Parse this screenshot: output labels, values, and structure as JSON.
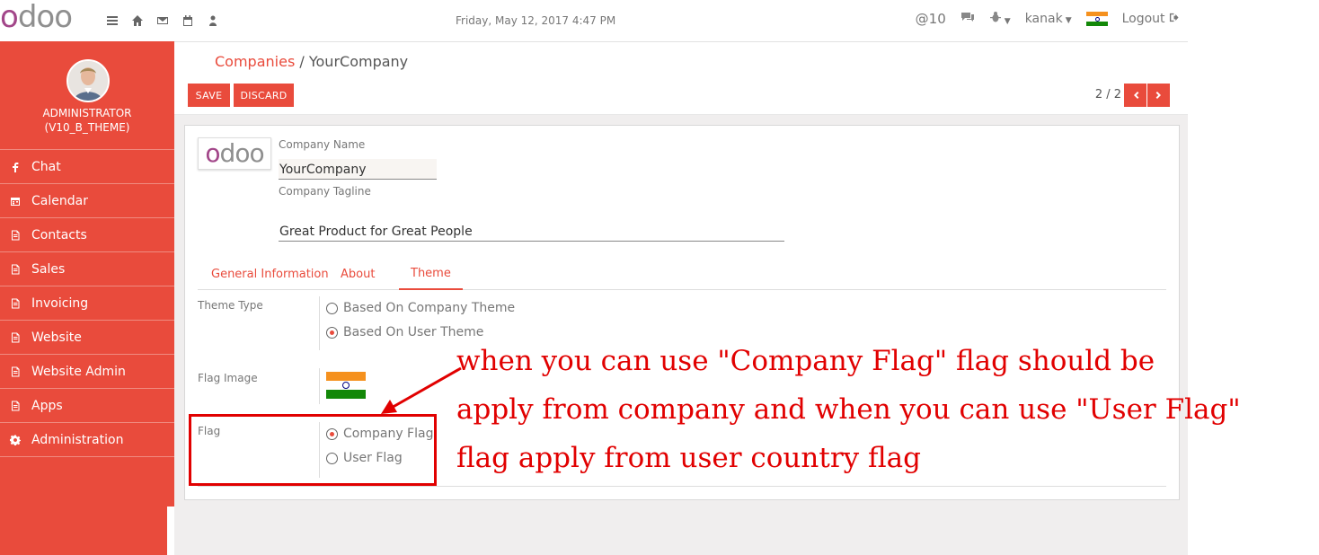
{
  "topbar": {
    "logo_first": "o",
    "logo_rest": "doo",
    "datetime": "Friday, May 12, 2017 4:47 PM",
    "mentions": "@10",
    "user": "kanak",
    "logout": "Logout",
    "icons": [
      "menu-icon",
      "home-icon",
      "envelope-icon",
      "calendar-icon",
      "user-icon"
    ]
  },
  "sidebar": {
    "user_line1": "ADMINISTRATOR",
    "user_line2": "(V10_B_THEME)",
    "items": [
      {
        "label": "Chat",
        "icon": "facebook-icon"
      },
      {
        "label": "Calendar",
        "icon": "calendar-icon"
      },
      {
        "label": "Contacts",
        "icon": "document-icon"
      },
      {
        "label": "Sales",
        "icon": "document-icon"
      },
      {
        "label": "Invoicing",
        "icon": "document-icon"
      },
      {
        "label": "Website",
        "icon": "document-icon"
      },
      {
        "label": "Website Admin",
        "icon": "document-icon"
      },
      {
        "label": "Apps",
        "icon": "document-icon"
      },
      {
        "label": "Administration",
        "icon": "gear-icon"
      }
    ]
  },
  "control_panel": {
    "breadcrumb_parent": "Companies",
    "breadcrumb_sep": "/",
    "breadcrumb_current": "YourCompany",
    "save_label": "SAVE",
    "discard_label": "DISCARD",
    "pager": "2 / 2"
  },
  "form": {
    "logo_first": "o",
    "logo_rest": "doo",
    "company_name_label": "Company Name",
    "company_name_value": "YourCompany",
    "tagline_label": "Company Tagline",
    "tagline_value": "Great Product for Great People",
    "tabs": [
      "General Information",
      "About",
      "Theme"
    ],
    "active_tab": "Theme",
    "theme_type_label": "Theme Type",
    "theme_options": [
      "Based On Company Theme",
      "Based On User Theme"
    ],
    "theme_selected": "Based On User Theme",
    "flag_image_label": "Flag Image",
    "flag_label": "Flag",
    "flag_options": [
      "Company Flag",
      "User Flag"
    ],
    "flag_selected": "Company Flag"
  },
  "annotation": {
    "line1": "when you can use \"Company Flag\" flag should be",
    "line2": "apply from company and when you can use \"User Flag\"",
    "line3": "flag apply from user country flag"
  },
  "colors": {
    "accent": "#e94b3c",
    "annotation": "#e10000",
    "flag_saffron": "#f5911e",
    "flag_green": "#138808",
    "flag_chakra": "#000080"
  }
}
